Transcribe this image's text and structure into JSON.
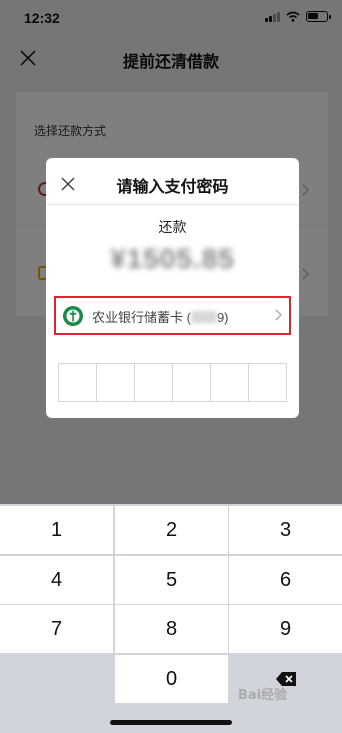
{
  "status_bar": {
    "time": "12:32"
  },
  "page": {
    "title": "提前还清借款",
    "section_title": "选择还款方式"
  },
  "dialog": {
    "title": "请输入支付密码",
    "label": "还款",
    "amount": "¥1505.85",
    "card_prefix": "农业银行储蓄卡 (",
    "card_suffix": "9)"
  },
  "keypad": {
    "keys": [
      "1",
      "2",
      "3",
      "4",
      "5",
      "6",
      "7",
      "8",
      "9",
      "0"
    ]
  },
  "watermark": "Bai经验",
  "colors": {
    "highlight": "#d9262c",
    "bank": "#1b8a4a"
  }
}
